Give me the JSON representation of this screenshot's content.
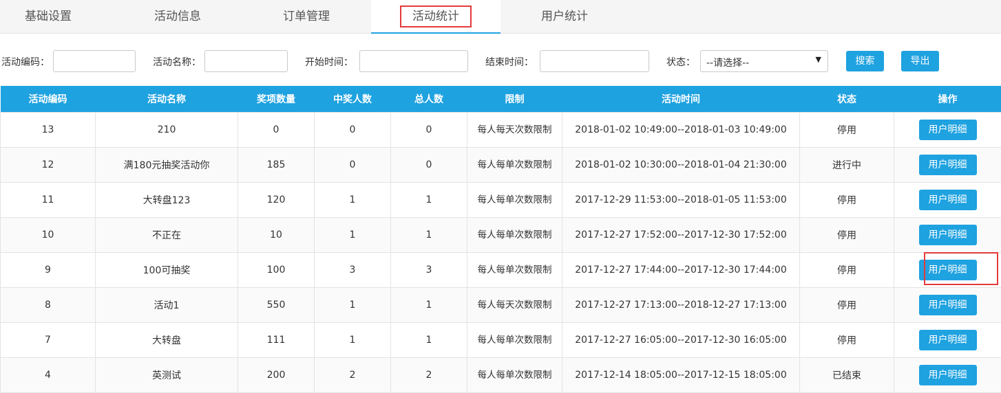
{
  "tabs": [
    {
      "label": "基础设置"
    },
    {
      "label": "活动信息"
    },
    {
      "label": "订单管理"
    },
    {
      "label": "活动统计",
      "active": true
    },
    {
      "label": "用户统计"
    }
  ],
  "filters": {
    "code_label": "活动编码：",
    "name_label": "活动名称：",
    "start_label": "开始时间：",
    "end_label": "结束时间：",
    "status_label": "状态：",
    "status_value": "--请选择--",
    "search_button": "搜索",
    "export_button": "导出"
  },
  "table": {
    "headers": [
      "活动编码",
      "活动名称",
      "奖项数量",
      "中奖人数",
      "总人数",
      "限制",
      "活动时间",
      "状态",
      "操作"
    ],
    "action_label": "用户明细",
    "rows": [
      {
        "code": "13",
        "name": "210",
        "prizes": "0",
        "winners": "0",
        "total": "0",
        "limit": "每人每天次数限制",
        "time": "2018-01-02 10:49:00--2018-01-03 10:49:00",
        "status": "停用"
      },
      {
        "code": "12",
        "name": "满180元抽奖活动你",
        "prizes": "185",
        "winners": "0",
        "total": "0",
        "limit": "每人每单次数限制",
        "time": "2018-01-02 10:30:00--2018-01-04 21:30:00",
        "status": "进行中"
      },
      {
        "code": "11",
        "name": "大转盘123",
        "prizes": "120",
        "winners": "1",
        "total": "1",
        "limit": "每人每单次数限制",
        "time": "2017-12-29 11:53:00--2018-01-05 11:53:00",
        "status": "停用"
      },
      {
        "code": "10",
        "name": "不正在",
        "prizes": "10",
        "winners": "1",
        "total": "1",
        "limit": "每人每单次数限制",
        "time": "2017-12-27 17:52:00--2017-12-30 17:52:00",
        "status": "停用"
      },
      {
        "code": "9",
        "name": "100可抽奖",
        "prizes": "100",
        "winners": "3",
        "total": "3",
        "limit": "每人每单次数限制",
        "time": "2017-12-27 17:44:00--2017-12-30 17:44:00",
        "status": "停用"
      },
      {
        "code": "8",
        "name": "活动1",
        "prizes": "550",
        "winners": "1",
        "total": "1",
        "limit": "每人每天次数限制",
        "time": "2017-12-27 17:13:00--2018-12-27 17:13:00",
        "status": "停用"
      },
      {
        "code": "7",
        "name": "大转盘",
        "prizes": "111",
        "winners": "1",
        "total": "1",
        "limit": "每人每单次数限制",
        "time": "2017-12-27 16:05:00--2017-12-30 16:05:00",
        "status": "停用"
      },
      {
        "code": "4",
        "name": "英测试",
        "prizes": "200",
        "winners": "2",
        "total": "2",
        "limit": "每人每单次数限制",
        "time": "2017-12-14 18:05:00--2017-12-15 18:05:00",
        "status": "已结束"
      }
    ]
  },
  "colors": {
    "accent": "#1fa2e0",
    "highlight": "#e53a3a"
  }
}
